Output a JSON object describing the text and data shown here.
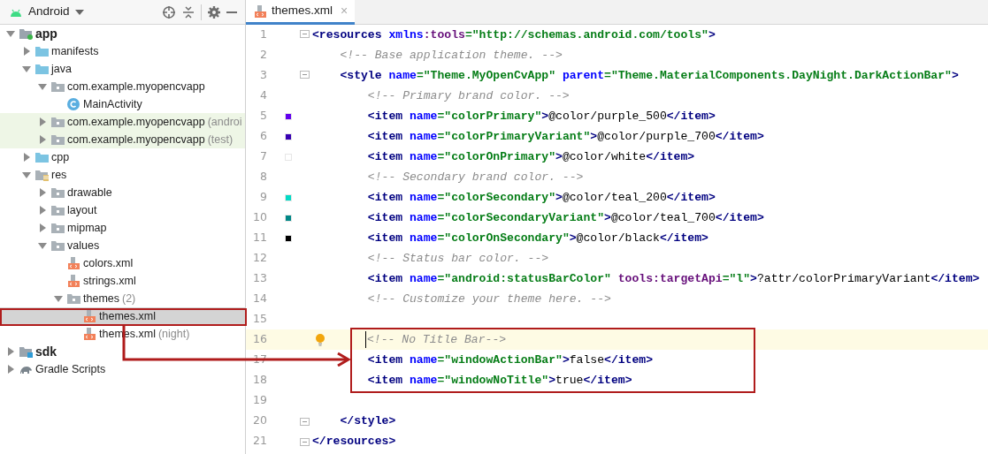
{
  "project_panel": {
    "view_selector": "Android",
    "tree": [
      {
        "label": "app",
        "kind": "module",
        "bold": true,
        "expanded": true,
        "selected": false,
        "highlighted": false,
        "children": [
          {
            "label": "manifests",
            "kind": "source-folder",
            "expanded": false,
            "selected": false,
            "highlighted": false
          },
          {
            "label": "java",
            "kind": "source-folder",
            "expanded": true,
            "selected": false,
            "highlighted": false,
            "children": [
              {
                "label": "com.example.myopencvapp",
                "kind": "package",
                "expanded": true,
                "selected": false,
                "highlighted": false,
                "children": [
                  {
                    "label": "MainActivity",
                    "kind": "class",
                    "selected": false,
                    "highlighted": false
                  }
                ]
              },
              {
                "label": "com.example.myopencvapp",
                "suffix": "(androi",
                "kind": "package",
                "expanded": false,
                "selected": false,
                "highlighted": true
              },
              {
                "label": "com.example.myopencvapp",
                "suffix": "(test)",
                "kind": "package",
                "expanded": false,
                "selected": false,
                "highlighted": true
              }
            ]
          },
          {
            "label": "cpp",
            "kind": "source-folder",
            "expanded": false,
            "selected": false,
            "highlighted": false
          },
          {
            "label": "res",
            "kind": "res-folder",
            "expanded": true,
            "selected": false,
            "highlighted": false,
            "children": [
              {
                "label": "drawable",
                "kind": "package",
                "expanded": false,
                "selected": false,
                "highlighted": false
              },
              {
                "label": "layout",
                "kind": "package",
                "expanded": false,
                "selected": false,
                "highlighted": false
              },
              {
                "label": "mipmap",
                "kind": "package",
                "expanded": false,
                "selected": false,
                "highlighted": false
              },
              {
                "label": "values",
                "kind": "package",
                "expanded": true,
                "selected": false,
                "highlighted": false,
                "children": [
                  {
                    "label": "colors.xml",
                    "kind": "xml",
                    "selected": false,
                    "highlighted": false
                  },
                  {
                    "label": "strings.xml",
                    "kind": "xml",
                    "selected": false,
                    "highlighted": false
                  },
                  {
                    "label": "themes",
                    "suffix": "(2)",
                    "kind": "package",
                    "expanded": true,
                    "selected": false,
                    "highlighted": false,
                    "children": [
                      {
                        "label": "themes.xml",
                        "kind": "xml",
                        "selected": true,
                        "highlighted": false
                      },
                      {
                        "label": "themes.xml",
                        "suffix": "(night)",
                        "kind": "xml",
                        "selected": false,
                        "highlighted": false
                      }
                    ]
                  }
                ]
              }
            ]
          }
        ]
      },
      {
        "label": "sdk",
        "kind": "library-module",
        "bold": true,
        "expanded": false,
        "selected": false,
        "highlighted": false
      },
      {
        "label": "Gradle Scripts",
        "kind": "gradle",
        "expanded": false,
        "selected": false,
        "highlighted": false
      }
    ]
  },
  "editor": {
    "tabs": [
      {
        "label": "themes.xml",
        "close": "×",
        "selected": true
      }
    ],
    "lines": [
      {
        "number": "1",
        "fold_start": true,
        "current": false,
        "tokens": [
          {
            "kind": "tag",
            "text": "<resources"
          },
          {
            "kind": "attr",
            "text": " xmlns"
          },
          {
            "kind": "ns",
            "text": ":tools"
          },
          {
            "kind": "value",
            "text": "=\"http://schemas.android.com/tools\""
          },
          {
            "kind": "tag",
            "text": ">"
          }
        ]
      },
      {
        "number": "2",
        "current": false,
        "tokens": [
          {
            "kind": "comment",
            "text": "    <!-- Base application theme. -->"
          }
        ]
      },
      {
        "number": "3",
        "fold_start": true,
        "current": false,
        "tokens": [
          {
            "kind": "tag",
            "text": "    <style"
          },
          {
            "kind": "attr",
            "text": " name"
          },
          {
            "kind": "value",
            "text": "=\"Theme.MyOpenCvApp\""
          },
          {
            "kind": "attr",
            "text": " parent"
          },
          {
            "kind": "value",
            "text": "=\"Theme.MaterialComponents.DayNight.DarkActionBar\""
          },
          {
            "kind": "tag",
            "text": ">"
          }
        ]
      },
      {
        "number": "4",
        "current": false,
        "tokens": [
          {
            "kind": "comment",
            "text": "        <!-- Primary brand color. -->"
          }
        ]
      },
      {
        "number": "5",
        "color": "#6200ee",
        "current": false,
        "tokens": [
          {
            "kind": "tag",
            "text": "        <item"
          },
          {
            "kind": "attr",
            "text": " name"
          },
          {
            "kind": "value",
            "text": "=\"colorPrimary\""
          },
          {
            "kind": "tag",
            "text": ">"
          },
          {
            "kind": "text",
            "text": "@color/purple_500"
          },
          {
            "kind": "tag",
            "text": "</item>"
          }
        ]
      },
      {
        "number": "6",
        "color": "#3700b3",
        "current": false,
        "tokens": [
          {
            "kind": "tag",
            "text": "        <item"
          },
          {
            "kind": "attr",
            "text": " name"
          },
          {
            "kind": "value",
            "text": "=\"colorPrimaryVariant\""
          },
          {
            "kind": "tag",
            "text": ">"
          },
          {
            "kind": "text",
            "text": "@color/purple_700"
          },
          {
            "kind": "tag",
            "text": "</item>"
          }
        ]
      },
      {
        "number": "7",
        "color": "#ffffff",
        "current": false,
        "tokens": [
          {
            "kind": "tag",
            "text": "        <item"
          },
          {
            "kind": "attr",
            "text": " name"
          },
          {
            "kind": "value",
            "text": "=\"colorOnPrimary\""
          },
          {
            "kind": "tag",
            "text": ">"
          },
          {
            "kind": "text",
            "text": "@color/white"
          },
          {
            "kind": "tag",
            "text": "</item>"
          }
        ]
      },
      {
        "number": "8",
        "current": false,
        "tokens": [
          {
            "kind": "comment",
            "text": "        <!-- Secondary brand color. -->"
          }
        ]
      },
      {
        "number": "9",
        "color": "#03dac5",
        "current": false,
        "tokens": [
          {
            "kind": "tag",
            "text": "        <item"
          },
          {
            "kind": "attr",
            "text": " name"
          },
          {
            "kind": "value",
            "text": "=\"colorSecondary\""
          },
          {
            "kind": "tag",
            "text": ">"
          },
          {
            "kind": "text",
            "text": "@color/teal_200"
          },
          {
            "kind": "tag",
            "text": "</item>"
          }
        ]
      },
      {
        "number": "10",
        "color": "#018786",
        "current": false,
        "tokens": [
          {
            "kind": "tag",
            "text": "        <item"
          },
          {
            "kind": "attr",
            "text": " name"
          },
          {
            "kind": "value",
            "text": "=\"colorSecondaryVariant\""
          },
          {
            "kind": "tag",
            "text": ">"
          },
          {
            "kind": "text",
            "text": "@color/teal_700"
          },
          {
            "kind": "tag",
            "text": "</item>"
          }
        ]
      },
      {
        "number": "11",
        "color": "#000000",
        "current": false,
        "tokens": [
          {
            "kind": "tag",
            "text": "        <item"
          },
          {
            "kind": "attr",
            "text": " name"
          },
          {
            "kind": "value",
            "text": "=\"colorOnSecondary\""
          },
          {
            "kind": "tag",
            "text": ">"
          },
          {
            "kind": "text",
            "text": "@color/black"
          },
          {
            "kind": "tag",
            "text": "</item>"
          }
        ]
      },
      {
        "number": "12",
        "current": false,
        "tokens": [
          {
            "kind": "comment",
            "text": "        <!-- Status bar color. -->"
          }
        ]
      },
      {
        "number": "13",
        "current": false,
        "tokens": [
          {
            "kind": "tag",
            "text": "        <item"
          },
          {
            "kind": "attr",
            "text": " name"
          },
          {
            "kind": "value",
            "text": "=\"android:statusBarColor\""
          },
          {
            "kind": "ns",
            "text": " tools:targetApi"
          },
          {
            "kind": "value",
            "text": "=\"l\""
          },
          {
            "kind": "tag",
            "text": ">"
          },
          {
            "kind": "text",
            "text": "?attr/colorPrimaryVariant"
          },
          {
            "kind": "tag",
            "text": "</item>"
          }
        ]
      },
      {
        "number": "14",
        "current": false,
        "tokens": [
          {
            "kind": "comment",
            "text": "        <!-- Customize your theme here. -->"
          }
        ]
      },
      {
        "number": "15",
        "current": false
      },
      {
        "number": "16",
        "current": true,
        "hint": true,
        "tokens": [
          {
            "kind": "comment",
            "text": "<!-- No Title Bar-->"
          }
        ]
      },
      {
        "number": "17",
        "current": false,
        "tokens": [
          {
            "kind": "tag",
            "text": "        <item"
          },
          {
            "kind": "attr",
            "text": " name"
          },
          {
            "kind": "value",
            "text": "=\"windowActionBar\""
          },
          {
            "kind": "tag",
            "text": ">"
          },
          {
            "kind": "text",
            "text": "false"
          },
          {
            "kind": "tag",
            "text": "</item>"
          }
        ]
      },
      {
        "number": "18",
        "current": false,
        "tokens": [
          {
            "kind": "tag",
            "text": "        <item"
          },
          {
            "kind": "attr",
            "text": " name"
          },
          {
            "kind": "value",
            "text": "=\"windowNoTitle\""
          },
          {
            "kind": "tag",
            "text": ">"
          },
          {
            "kind": "text",
            "text": "true"
          },
          {
            "kind": "tag",
            "text": "</item>"
          }
        ]
      },
      {
        "number": "19",
        "current": false
      },
      {
        "number": "20",
        "fold_end": true,
        "current": false,
        "tokens": [
          {
            "kind": "tag",
            "text": "    </style>"
          }
        ]
      },
      {
        "number": "21",
        "fold_end": true,
        "current": false,
        "tokens": [
          {
            "kind": "tag",
            "text": "</resources>"
          }
        ]
      }
    ]
  }
}
